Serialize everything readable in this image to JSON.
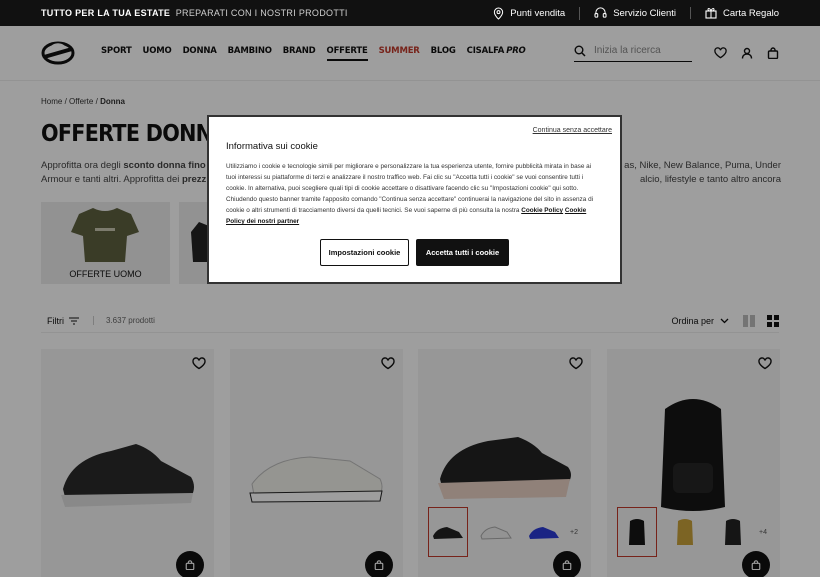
{
  "topbar": {
    "promo_bold": "TUTTO PER LA TUA ESTATE",
    "promo_sub": "PREPARATI CON I NOSTRI PRODOTTI",
    "links": [
      {
        "label": "Punti vendita",
        "icon": "location-pin-icon"
      },
      {
        "label": "Servizio Clienti",
        "icon": "headset-icon"
      },
      {
        "label": "Carta Regalo",
        "icon": "gift-icon"
      }
    ]
  },
  "nav": {
    "items": [
      "SPORT",
      "UOMO",
      "DONNA",
      "BAMBINO",
      "BRAND",
      "OFFERTE",
      "SUMMER",
      "BLOG"
    ],
    "cisalfa": "CISALFA",
    "pro": "PRO",
    "active_color": "#c0392b"
  },
  "search": {
    "placeholder": "Inizia la ricerca"
  },
  "breadcrumb": {
    "home": "Home",
    "sep": "/",
    "offerte": "Offerte",
    "current": "Donna"
  },
  "page": {
    "title": "OFFERTE DONNA",
    "desc_line1_start": "Approfitta ora degli ",
    "desc_line1_bold": "sconto donna fino a",
    "desc_line1_end": "as, Nike, New Balance, Puma, Under",
    "desc_line2_start": "Armour e tanti altri. Approfitta dei ",
    "desc_line2_bold": "prezz",
    "desc_line2_end": "alcio, lifestyle e tanto altro ancora"
  },
  "categories": [
    {
      "label": "OFFERTE UOMO"
    },
    {
      "label": "O"
    }
  ],
  "toolbar": {
    "filters_label": "Filtri",
    "count": "3.637 prodotti",
    "sort_label": "Ordina per"
  },
  "products": [
    {
      "name": "sneaker-black"
    },
    {
      "name": "sneaker-white"
    },
    {
      "name": "running-shoe-black",
      "more": "+2"
    },
    {
      "name": "backpack-black",
      "more": "+4"
    }
  ],
  "cookie": {
    "skip": "Continua senza accettare",
    "title": "Informativa sui cookie",
    "body": "Utilizziamo i cookie e tecnologie simili per migliorare e personalizzare la tua esperienza utente, fornire pubblicità mirata in base ai tuoi interessi su piattaforme di terzi e analizzare il nostro traffico web. Fai clic su \"Accetta tutti i cookie\" se vuoi consentire tutti i cookie. In alternativa, puoi scegliere quali tipi di cookie accettare o disattivare facendo clic su \"Impostazioni cookie\" qui sotto. Chiudendo questo banner tramite l'apposito comando \"Continua senza accettare\" continuerai la navigazione del sito in assenza di cookie o altri strumenti di tracciamento diversi da quelli tecnici. Se vuoi saperne di più consulta la nostra",
    "link1": "Cookie Policy",
    "link2": "Cookie Policy dei nostri partner",
    "settings_btn": "Impostazioni cookie",
    "accept_btn": "Accetta tutti i cookie"
  }
}
